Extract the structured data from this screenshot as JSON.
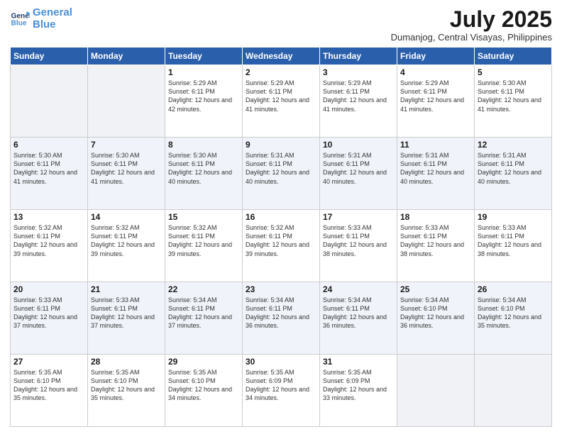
{
  "header": {
    "logo_line1": "General",
    "logo_line2": "Blue",
    "month": "July 2025",
    "location": "Dumanjog, Central Visayas, Philippines"
  },
  "days_of_week": [
    "Sunday",
    "Monday",
    "Tuesday",
    "Wednesday",
    "Thursday",
    "Friday",
    "Saturday"
  ],
  "weeks": [
    [
      {
        "day": "",
        "info": ""
      },
      {
        "day": "",
        "info": ""
      },
      {
        "day": "1",
        "info": "Sunrise: 5:29 AM\nSunset: 6:11 PM\nDaylight: 12 hours and 42 minutes."
      },
      {
        "day": "2",
        "info": "Sunrise: 5:29 AM\nSunset: 6:11 PM\nDaylight: 12 hours and 41 minutes."
      },
      {
        "day": "3",
        "info": "Sunrise: 5:29 AM\nSunset: 6:11 PM\nDaylight: 12 hours and 41 minutes."
      },
      {
        "day": "4",
        "info": "Sunrise: 5:29 AM\nSunset: 6:11 PM\nDaylight: 12 hours and 41 minutes."
      },
      {
        "day": "5",
        "info": "Sunrise: 5:30 AM\nSunset: 6:11 PM\nDaylight: 12 hours and 41 minutes."
      }
    ],
    [
      {
        "day": "6",
        "info": "Sunrise: 5:30 AM\nSunset: 6:11 PM\nDaylight: 12 hours and 41 minutes."
      },
      {
        "day": "7",
        "info": "Sunrise: 5:30 AM\nSunset: 6:11 PM\nDaylight: 12 hours and 41 minutes."
      },
      {
        "day": "8",
        "info": "Sunrise: 5:30 AM\nSunset: 6:11 PM\nDaylight: 12 hours and 40 minutes."
      },
      {
        "day": "9",
        "info": "Sunrise: 5:31 AM\nSunset: 6:11 PM\nDaylight: 12 hours and 40 minutes."
      },
      {
        "day": "10",
        "info": "Sunrise: 5:31 AM\nSunset: 6:11 PM\nDaylight: 12 hours and 40 minutes."
      },
      {
        "day": "11",
        "info": "Sunrise: 5:31 AM\nSunset: 6:11 PM\nDaylight: 12 hours and 40 minutes."
      },
      {
        "day": "12",
        "info": "Sunrise: 5:31 AM\nSunset: 6:11 PM\nDaylight: 12 hours and 40 minutes."
      }
    ],
    [
      {
        "day": "13",
        "info": "Sunrise: 5:32 AM\nSunset: 6:11 PM\nDaylight: 12 hours and 39 minutes."
      },
      {
        "day": "14",
        "info": "Sunrise: 5:32 AM\nSunset: 6:11 PM\nDaylight: 12 hours and 39 minutes."
      },
      {
        "day": "15",
        "info": "Sunrise: 5:32 AM\nSunset: 6:11 PM\nDaylight: 12 hours and 39 minutes."
      },
      {
        "day": "16",
        "info": "Sunrise: 5:32 AM\nSunset: 6:11 PM\nDaylight: 12 hours and 39 minutes."
      },
      {
        "day": "17",
        "info": "Sunrise: 5:33 AM\nSunset: 6:11 PM\nDaylight: 12 hours and 38 minutes."
      },
      {
        "day": "18",
        "info": "Sunrise: 5:33 AM\nSunset: 6:11 PM\nDaylight: 12 hours and 38 minutes."
      },
      {
        "day": "19",
        "info": "Sunrise: 5:33 AM\nSunset: 6:11 PM\nDaylight: 12 hours and 38 minutes."
      }
    ],
    [
      {
        "day": "20",
        "info": "Sunrise: 5:33 AM\nSunset: 6:11 PM\nDaylight: 12 hours and 37 minutes."
      },
      {
        "day": "21",
        "info": "Sunrise: 5:33 AM\nSunset: 6:11 PM\nDaylight: 12 hours and 37 minutes."
      },
      {
        "day": "22",
        "info": "Sunrise: 5:34 AM\nSunset: 6:11 PM\nDaylight: 12 hours and 37 minutes."
      },
      {
        "day": "23",
        "info": "Sunrise: 5:34 AM\nSunset: 6:11 PM\nDaylight: 12 hours and 36 minutes."
      },
      {
        "day": "24",
        "info": "Sunrise: 5:34 AM\nSunset: 6:11 PM\nDaylight: 12 hours and 36 minutes."
      },
      {
        "day": "25",
        "info": "Sunrise: 5:34 AM\nSunset: 6:10 PM\nDaylight: 12 hours and 36 minutes."
      },
      {
        "day": "26",
        "info": "Sunrise: 5:34 AM\nSunset: 6:10 PM\nDaylight: 12 hours and 35 minutes."
      }
    ],
    [
      {
        "day": "27",
        "info": "Sunrise: 5:35 AM\nSunset: 6:10 PM\nDaylight: 12 hours and 35 minutes."
      },
      {
        "day": "28",
        "info": "Sunrise: 5:35 AM\nSunset: 6:10 PM\nDaylight: 12 hours and 35 minutes."
      },
      {
        "day": "29",
        "info": "Sunrise: 5:35 AM\nSunset: 6:10 PM\nDaylight: 12 hours and 34 minutes."
      },
      {
        "day": "30",
        "info": "Sunrise: 5:35 AM\nSunset: 6:09 PM\nDaylight: 12 hours and 34 minutes."
      },
      {
        "day": "31",
        "info": "Sunrise: 5:35 AM\nSunset: 6:09 PM\nDaylight: 12 hours and 33 minutes."
      },
      {
        "day": "",
        "info": ""
      },
      {
        "day": "",
        "info": ""
      }
    ]
  ]
}
